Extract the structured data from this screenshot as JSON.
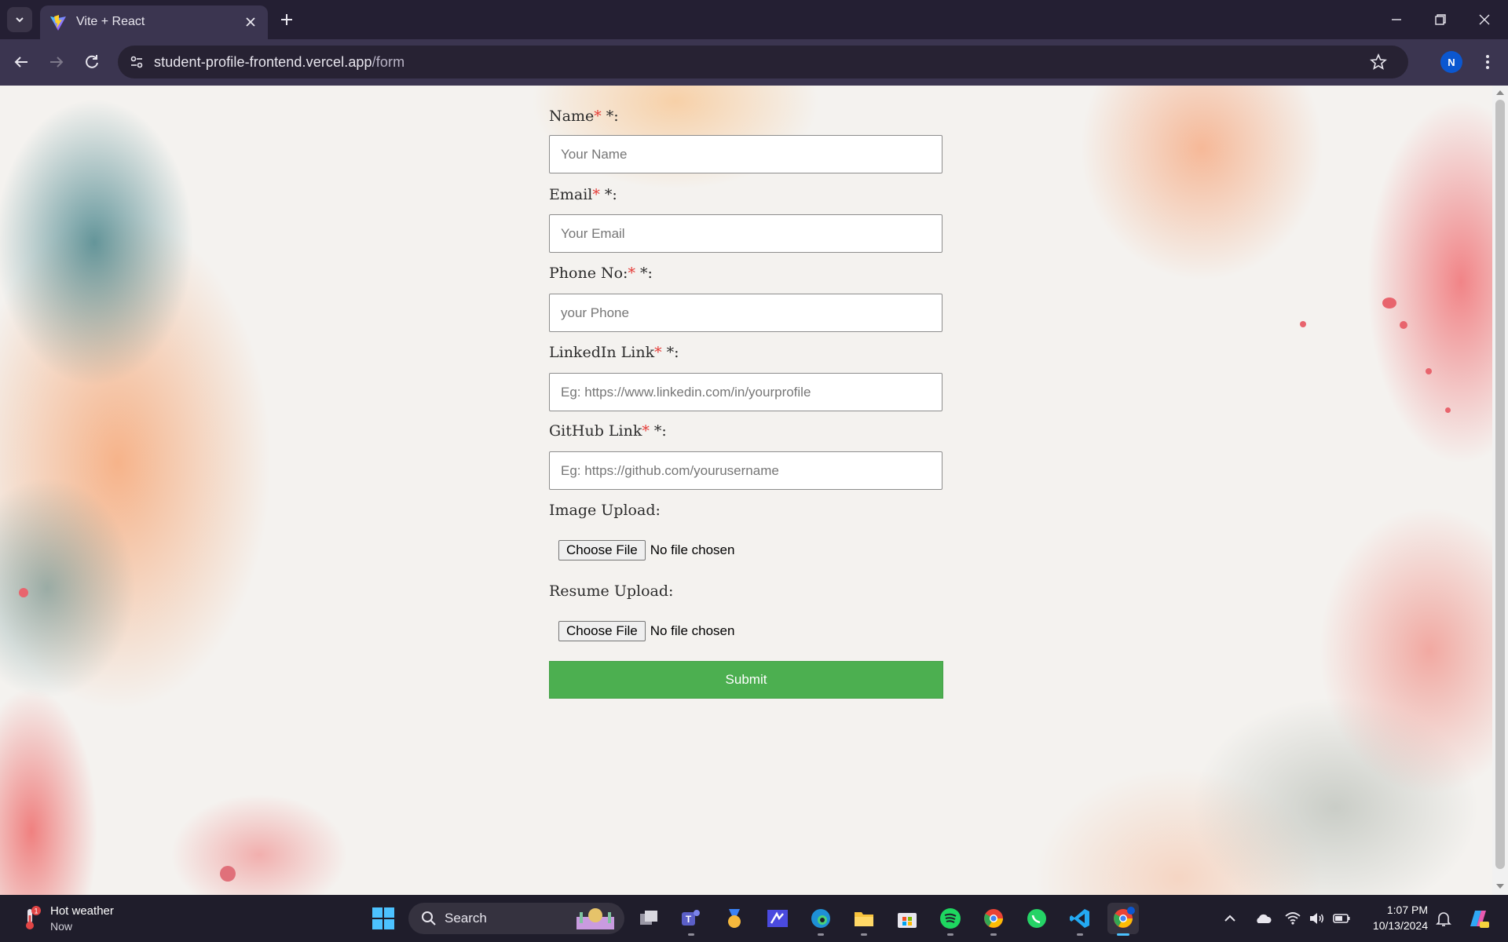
{
  "browser": {
    "tab_title": "Vite + React",
    "url_host": "student-profile-frontend.vercel.app",
    "url_path": "/form",
    "profile_initial": "N"
  },
  "form": {
    "fields": [
      {
        "label": "Name",
        "required_mark": "*",
        "suffix": " *:",
        "placeholder": "Your Name"
      },
      {
        "label": "Email",
        "required_mark": "*",
        "suffix": " *:",
        "placeholder": "Your Email"
      },
      {
        "label": "Phone No:",
        "required_mark": "*",
        "suffix": " *:",
        "placeholder": "your Phone"
      },
      {
        "label": "LinkedIn Link",
        "required_mark": "*",
        "suffix": " *:",
        "placeholder": "Eg: https://www.linkedin.com/in/yourprofile"
      },
      {
        "label": "GitHub Link",
        "required_mark": "*",
        "suffix": " *:",
        "placeholder": "Eg: https://github.com/yourusername"
      }
    ],
    "uploads": [
      {
        "label": "Image Upload:",
        "button": "Choose File",
        "status": "No file chosen"
      },
      {
        "label": "Resume Upload:",
        "button": "Choose File",
        "status": "No file chosen"
      }
    ],
    "submit_label": "Submit"
  },
  "taskbar": {
    "weather_title": "Hot weather",
    "weather_sub": "Now",
    "weather_badge": "1",
    "search_label": "Search",
    "time": "1:07 PM",
    "date": "10/13/2024"
  },
  "colors": {
    "accent_submit": "#4caf50",
    "required_mark": "#e53935",
    "profile_badge": "#0b57d0"
  }
}
